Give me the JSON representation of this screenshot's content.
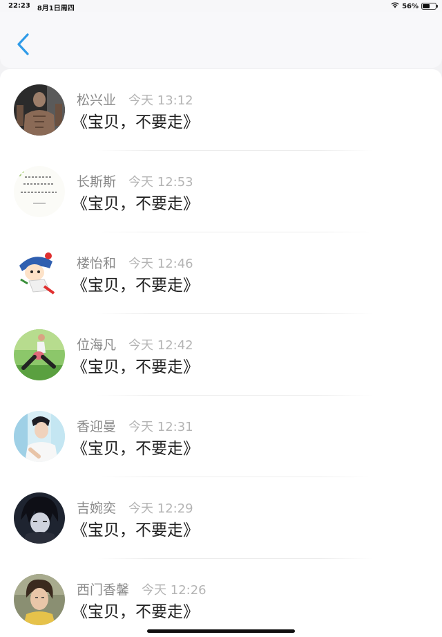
{
  "status_bar": {
    "time": "22:23",
    "date": "8月1日周四",
    "battery": "56%",
    "battery_level": 0.56
  },
  "nav": {
    "back_icon": "chevron-left-icon",
    "accent": "#2f9be8"
  },
  "messages": [
    {
      "name": "松兴业",
      "time": "今天 13:12",
      "text": "《宝贝，不要走》"
    },
    {
      "name": "长斯斯",
      "time": "今天 12:53",
      "text": "《宝贝，不要走》"
    },
    {
      "name": "楼怡和",
      "time": "今天 12:46",
      "text": "《宝贝，不要走》"
    },
    {
      "name": "位海凡",
      "time": "今天 12:42",
      "text": "《宝贝，不要走》"
    },
    {
      "name": "香迎曼",
      "time": "今天 12:31",
      "text": "《宝贝，不要走》"
    },
    {
      "name": "吉婉奕",
      "time": "今天 12:29",
      "text": "《宝贝，不要走》"
    },
    {
      "name": "西门香馨",
      "time": "今天 12:26",
      "text": "《宝贝，不要走》"
    }
  ]
}
